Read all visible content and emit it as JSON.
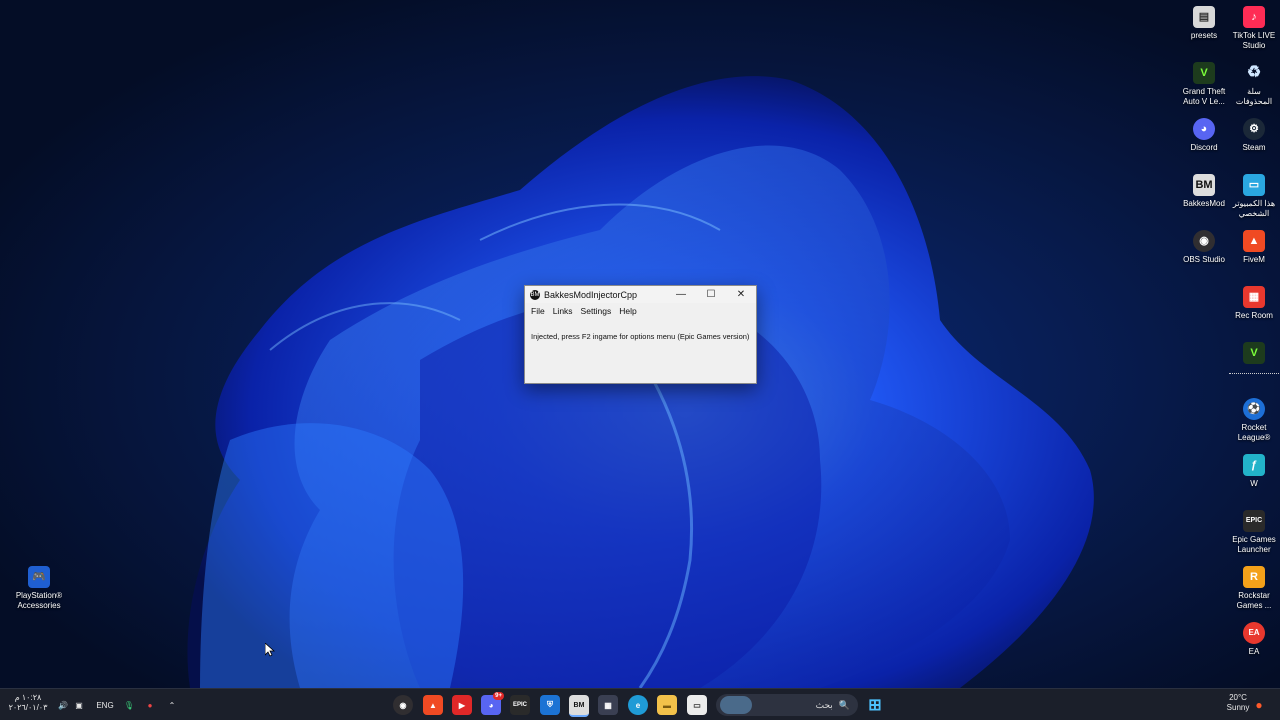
{
  "desktop": {
    "icons_right_col1": [
      {
        "label": "presets",
        "icon": "file-icon",
        "color": "#d8d8d8"
      },
      {
        "label": "Grand Theft Auto V Le...",
        "icon": "gta-icon",
        "color": "#2a7a2a"
      },
      {
        "label": "Discord",
        "icon": "discord-icon",
        "color": "#5865f2"
      },
      {
        "label": "BakkesMod",
        "icon": "bakkesmod-icon",
        "color": "#222222"
      },
      {
        "label": "OBS Studio",
        "icon": "obs-icon",
        "color": "#302e31"
      }
    ],
    "icons_right_col2": [
      {
        "label": "TikTok LIVE Studio",
        "icon": "tiktok-icon",
        "color": "#fe2c55"
      },
      {
        "label": "سلة المحذوفات",
        "icon": "recycle-bin-icon",
        "color": "#9fc6e8"
      },
      {
        "label": "Steam",
        "icon": "steam-icon",
        "color": "#1b2838"
      },
      {
        "label": "هذا الكمبيوتر الشخصي",
        "icon": "computer-icon",
        "color": "#2aa7e0"
      },
      {
        "label": "FiveM",
        "icon": "fivem-icon",
        "color": "#f04a23"
      },
      {
        "label": "Rec Room",
        "icon": "recroom-icon",
        "color": "#e8382e"
      },
      {
        "label": "",
        "icon": "gta-shortcut-icon",
        "color": "#2a7a2a"
      },
      {
        "label": "Rocket League®",
        "icon": "rocket-league-icon",
        "color": "#1d6fd6"
      },
      {
        "label": "W",
        "icon": "w-app-icon",
        "color": "#22b3c9"
      },
      {
        "label": "Epic Games Launcher",
        "icon": "epic-games-icon",
        "color": "#2a2a2a"
      },
      {
        "label": "Rockstar Games ...",
        "icon": "rockstar-icon",
        "color": "#f4a11a"
      },
      {
        "label": "EA",
        "icon": "ea-icon",
        "color": "#e8382e"
      }
    ],
    "icon_left": {
      "label": "PlayStation® Accessories",
      "icon": "playstation-icon",
      "color": "#1f5fd1"
    }
  },
  "window": {
    "title": "BakkesModInjectorCpp",
    "menu": [
      "File",
      "Links",
      "Settings",
      "Help"
    ],
    "message": "Injected, press F2 ingame for options menu (Epic Games version)",
    "minimize": "—",
    "maximize": "☐",
    "close": "✕"
  },
  "taskbar": {
    "clock_time": "١٠:٢٨ م",
    "clock_date": "٢٠٢٦/٠١/٠٣",
    "language": "ENG",
    "search_placeholder": "بحث",
    "discord_badge": "9+",
    "epic_label": "EPIC",
    "weather_temp": "20°C",
    "weather_desc": "Sunny",
    "accent": "#1b1f2a"
  }
}
